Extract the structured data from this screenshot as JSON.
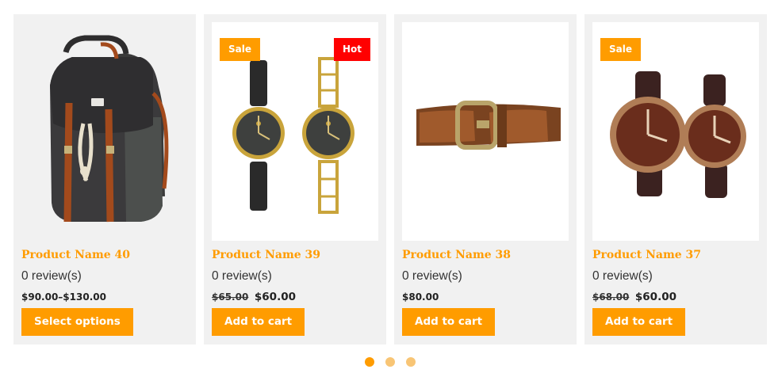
{
  "products": [
    {
      "name": "Product Name 40",
      "reviews": "0 review(s)",
      "price_range": "$90.00–$130.00",
      "button": "Select options",
      "image": "backpack-image"
    },
    {
      "name": "Product Name 39",
      "reviews": "0 review(s)",
      "old_price": "$65.00",
      "new_price": "$60.00",
      "button": "Add to cart",
      "badge_sale": "Sale",
      "badge_hot": "Hot",
      "image": "watches-pair-image"
    },
    {
      "name": "Product Name 38",
      "reviews": "0 review(s)",
      "price": "$80.00",
      "button": "Add to cart",
      "image": "leather-belt-image"
    },
    {
      "name": "Product Name 37",
      "reviews": "0 review(s)",
      "old_price": "$68.00",
      "new_price": "$60.00",
      "button": "Add to cart",
      "badge_sale": "Sale",
      "image": "brown-watches-image"
    }
  ],
  "colors": {
    "accent": "#ff9c00",
    "hot": "#ff0000",
    "card_bg": "#f1f1f1",
    "dot_inactive": "#f8c575"
  },
  "pagination": {
    "pages": 3,
    "active": 1
  }
}
